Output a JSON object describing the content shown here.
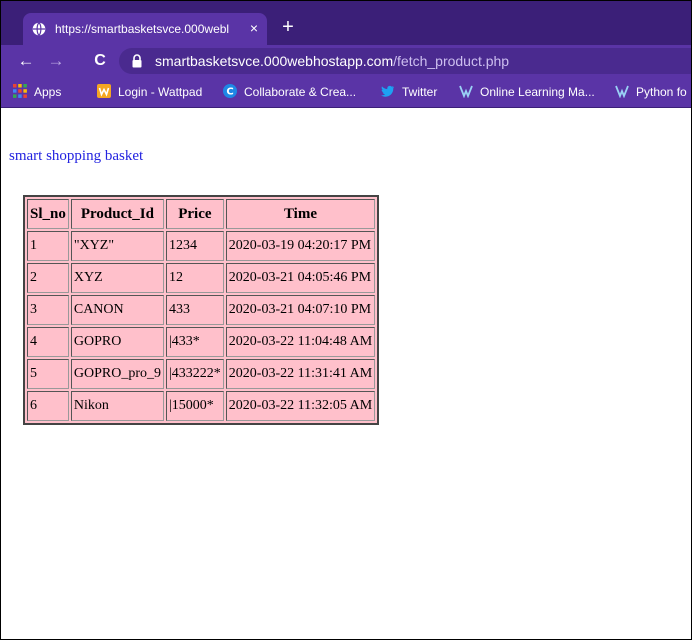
{
  "browser": {
    "tab": {
      "title": "https://smartbasketsvce.000webl",
      "close_icon": "×"
    },
    "new_tab_icon": "+",
    "nav": {
      "back": "←",
      "forward": "→",
      "reload": "C"
    },
    "address": {
      "host": "smartbasketsvce.000webhostapp.com",
      "path": "/fetch_product.php"
    },
    "bookmarks": [
      {
        "label": "Apps",
        "icon": "apps-grid-icon"
      },
      {
        "label": "Login - Wattpad",
        "icon": "wattpad-icon"
      },
      {
        "label": "Collaborate & Crea...",
        "icon": "collaborate-icon"
      },
      {
        "label": "Twitter",
        "icon": "twitter-icon"
      },
      {
        "label": "Online Learning Ma...",
        "icon": "online-learning-icon"
      },
      {
        "label": "Python fo",
        "icon": "python-icon"
      }
    ],
    "colors": {
      "tab_strip": "#3b1f78",
      "toolbar": "#5a34a6"
    }
  },
  "page": {
    "heading": "smart shopping basket",
    "heading_color": "#2323e0",
    "table_bg": "#ffc0cb",
    "table": {
      "columns": [
        "Sl_no",
        "Product_Id",
        "Price",
        "Time"
      ],
      "rows": [
        [
          "1",
          "\"XYZ\"",
          "1234",
          "2020-03-19 04:20:17 PM"
        ],
        [
          "2",
          "XYZ",
          "12",
          "2020-03-21 04:05:46 PM"
        ],
        [
          "3",
          "CANON",
          "433",
          "2020-03-21 04:07:10 PM"
        ],
        [
          "4",
          "GOPRO",
          "|433*",
          "2020-03-22 11:04:48 AM"
        ],
        [
          "5",
          "GOPRO_pro_9",
          "|433222*",
          "2020-03-22 11:31:41 AM"
        ],
        [
          "6",
          "Nikon",
          "|15000*",
          "2020-03-22 11:32:05 AM"
        ]
      ]
    }
  }
}
